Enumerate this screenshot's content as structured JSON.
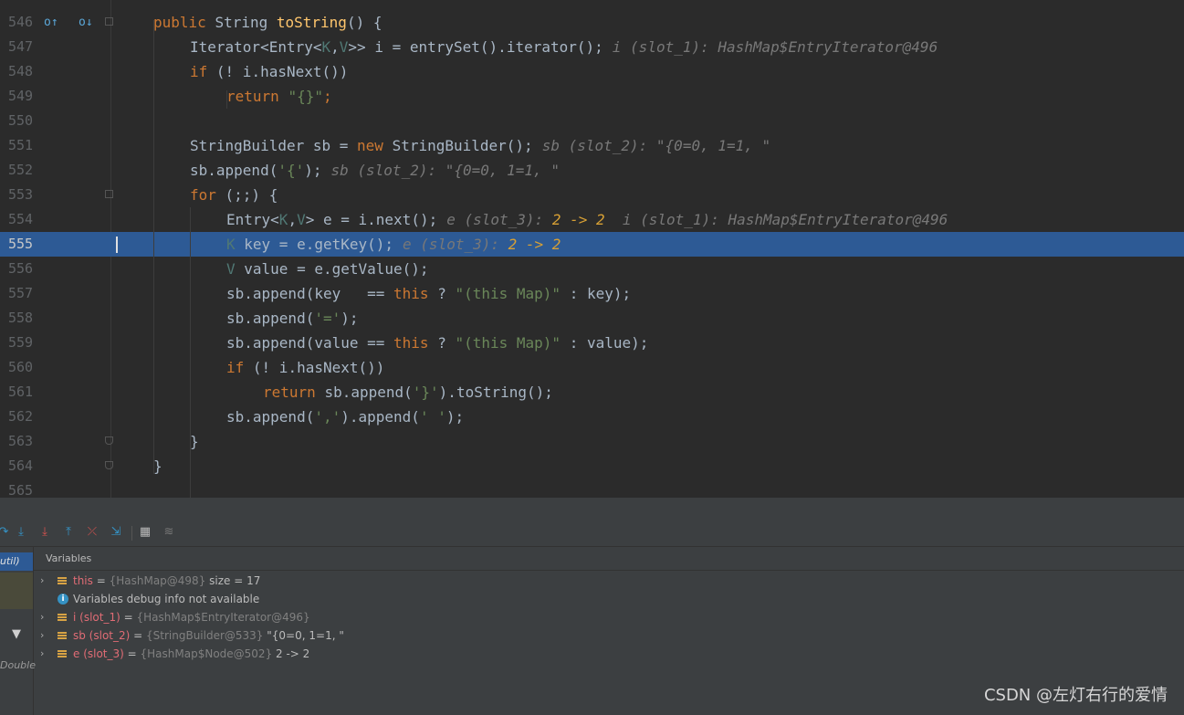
{
  "editor": {
    "lines": [
      {
        "num": "546",
        "tokens": [
          {
            "t": "public ",
            "c": "kw"
          },
          {
            "t": "String ",
            "c": ""
          },
          {
            "t": "toString",
            "c": "fn"
          },
          {
            "t": "() {",
            "c": ""
          }
        ],
        "hint": []
      },
      {
        "num": "547",
        "tokens": [
          {
            "t": "Iterator<Entry<",
            "c": ""
          },
          {
            "t": "K",
            "c": "gen"
          },
          {
            "t": ",",
            "c": ""
          },
          {
            "t": "V",
            "c": "gen"
          },
          {
            "t": ">> i = entrySet().iterator();",
            "c": ""
          }
        ],
        "hint": [
          {
            "t": "i (slot_1): HashMap$EntryIterator@496",
            "c": ""
          }
        ]
      },
      {
        "num": "548",
        "tokens": [
          {
            "t": "if ",
            "c": "kw"
          },
          {
            "t": "(! i.hasNext())",
            "c": ""
          }
        ],
        "hint": []
      },
      {
        "num": "549",
        "tokens": [
          {
            "t": "return ",
            "c": "kw"
          },
          {
            "t": "\"{}\"",
            "c": "str"
          },
          {
            "t": ";",
            "c": "kw"
          }
        ],
        "hint": []
      },
      {
        "num": "550",
        "tokens": [],
        "hint": []
      },
      {
        "num": "551",
        "tokens": [
          {
            "t": "StringBuilder sb = ",
            "c": ""
          },
          {
            "t": "new ",
            "c": "kw"
          },
          {
            "t": "StringBuilder();",
            "c": ""
          }
        ],
        "hint": [
          {
            "t": "sb (slot_2): \"{0=0, 1=1, \"",
            "c": ""
          }
        ]
      },
      {
        "num": "552",
        "tokens": [
          {
            "t": "sb.append(",
            "c": ""
          },
          {
            "t": "'{'",
            "c": "str"
          },
          {
            "t": ");",
            "c": ""
          }
        ],
        "hint": [
          {
            "t": "sb (slot_2): \"{0=0, 1=1, \"",
            "c": ""
          }
        ]
      },
      {
        "num": "553",
        "tokens": [
          {
            "t": "for ",
            "c": "kw"
          },
          {
            "t": "(;;) {",
            "c": ""
          }
        ],
        "hint": []
      },
      {
        "num": "554",
        "tokens": [
          {
            "t": "Entry<",
            "c": ""
          },
          {
            "t": "K",
            "c": "gen"
          },
          {
            "t": ",",
            "c": ""
          },
          {
            "t": "V",
            "c": "gen"
          },
          {
            "t": "> e = i.next();",
            "c": ""
          }
        ],
        "hint": [
          {
            "t": "e (slot_3): ",
            "c": ""
          },
          {
            "t": "2 -> 2",
            "c": "n"
          },
          {
            "t": "  i (slot_1): HashMap$EntryIterator@496",
            "c": ""
          }
        ]
      },
      {
        "num": "555",
        "tokens": [
          {
            "t": "K",
            "c": "gen"
          },
          {
            "t": " key = e.getKey();",
            "c": ""
          }
        ],
        "hint": [
          {
            "t": "e (slot_3): ",
            "c": ""
          },
          {
            "t": "2 -> 2",
            "c": "n"
          }
        ]
      },
      {
        "num": "556",
        "tokens": [
          {
            "t": "V",
            "c": "gen"
          },
          {
            "t": " value = e.getValue();",
            "c": ""
          }
        ],
        "hint": []
      },
      {
        "num": "557",
        "tokens": [
          {
            "t": "sb.append(key   == ",
            "c": ""
          },
          {
            "t": "this ",
            "c": "kw"
          },
          {
            "t": "? ",
            "c": ""
          },
          {
            "t": "\"(this Map)\"",
            "c": "str"
          },
          {
            "t": " : key);",
            "c": ""
          }
        ],
        "hint": []
      },
      {
        "num": "558",
        "tokens": [
          {
            "t": "sb.append(",
            "c": ""
          },
          {
            "t": "'='",
            "c": "str"
          },
          {
            "t": ");",
            "c": ""
          }
        ],
        "hint": []
      },
      {
        "num": "559",
        "tokens": [
          {
            "t": "sb.append(value == ",
            "c": ""
          },
          {
            "t": "this ",
            "c": "kw"
          },
          {
            "t": "? ",
            "c": ""
          },
          {
            "t": "\"(this Map)\"",
            "c": "str"
          },
          {
            "t": " : value);",
            "c": ""
          }
        ],
        "hint": []
      },
      {
        "num": "560",
        "tokens": [
          {
            "t": "if ",
            "c": "kw"
          },
          {
            "t": "(! i.hasNext())",
            "c": ""
          }
        ],
        "hint": []
      },
      {
        "num": "561",
        "tokens": [
          {
            "t": "return ",
            "c": "kw"
          },
          {
            "t": "sb.append(",
            "c": ""
          },
          {
            "t": "'}'",
            "c": "str"
          },
          {
            "t": ").toString();",
            "c": ""
          }
        ],
        "hint": []
      },
      {
        "num": "562",
        "tokens": [
          {
            "t": "sb.append(",
            "c": ""
          },
          {
            "t": "','",
            "c": "str"
          },
          {
            "t": ").append(",
            "c": ""
          },
          {
            "t": "' '",
            "c": "str"
          },
          {
            "t": ");",
            "c": ""
          }
        ],
        "hint": []
      },
      {
        "num": "563",
        "tokens": [
          {
            "t": "}",
            "c": ""
          }
        ],
        "hint": []
      },
      {
        "num": "564",
        "tokens": [
          {
            "t": "}",
            "c": ""
          }
        ],
        "hint": []
      },
      {
        "num": "565",
        "tokens": [],
        "hint": []
      }
    ],
    "current_line": "555"
  },
  "debug": {
    "variables_title": "Variables",
    "frame_selected_label": "util)",
    "frame_other_label": "Double",
    "variables": [
      {
        "expandable": true,
        "icon": "field-icon",
        "name": "this",
        "ref": "{HashMap@498}",
        "value": "size = 17"
      },
      {
        "expandable": false,
        "icon": "info-icon",
        "name": "",
        "ref": "",
        "value": "Variables debug info not available"
      },
      {
        "expandable": true,
        "icon": "field-icon",
        "name": "i (slot_1)",
        "ref": "{HashMap$EntryIterator@496}",
        "value": ""
      },
      {
        "expandable": true,
        "icon": "field-icon",
        "name": "sb (slot_2)",
        "ref": "{StringBuilder@533}",
        "value": "\"{0=0, 1=1, \""
      },
      {
        "expandable": true,
        "icon": "field-icon",
        "name": "e (slot_3)",
        "ref": "{HashMap$Node@502}",
        "value": "2 -> 2"
      }
    ]
  },
  "watermark": "CSDN @左灯右行的爱情"
}
